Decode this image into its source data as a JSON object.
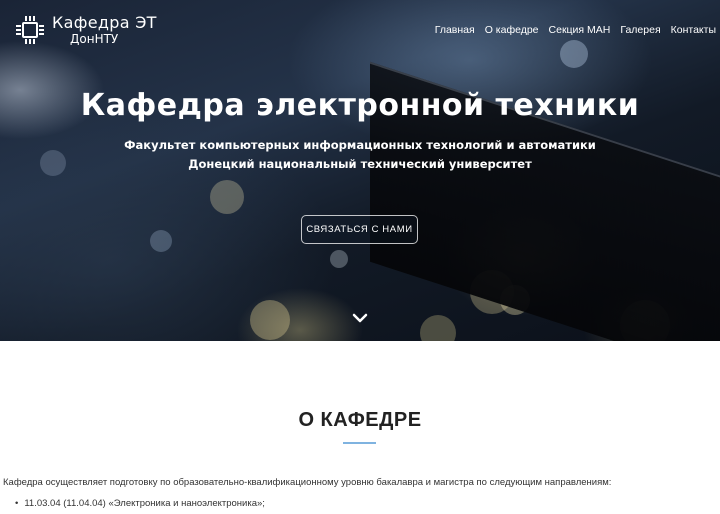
{
  "logo": {
    "title": "Кафедра ЭТ",
    "subtitle": "ДонНТУ",
    "icon": "chip-icon"
  },
  "nav": {
    "items": [
      "Главная",
      "О кафедре",
      "Секция МАН",
      "Галерея",
      "Контакты"
    ]
  },
  "hero": {
    "title": "Кафедра электронной техники",
    "subtitle_line1": "Факультет компьютерных информационных технологий и автоматики",
    "subtitle_line2": "Донецкий национальный технический университет",
    "cta_label": "СВЯЗАТЬСЯ С НАМИ",
    "scroll_icon": "chevron-down-icon"
  },
  "about": {
    "title": "О КАФЕДРЕ",
    "text": "Кафедра осуществляет подготовку по образовательно-квалификационному уровню бакалавра и магистра по следующим направлениям:",
    "items": [
      "11.03.04 (11.04.04) «Электроника и наноэлектроника»;"
    ]
  },
  "colors": {
    "accent_underline": "#7fb3e0",
    "hero_dark": "#121a26"
  }
}
